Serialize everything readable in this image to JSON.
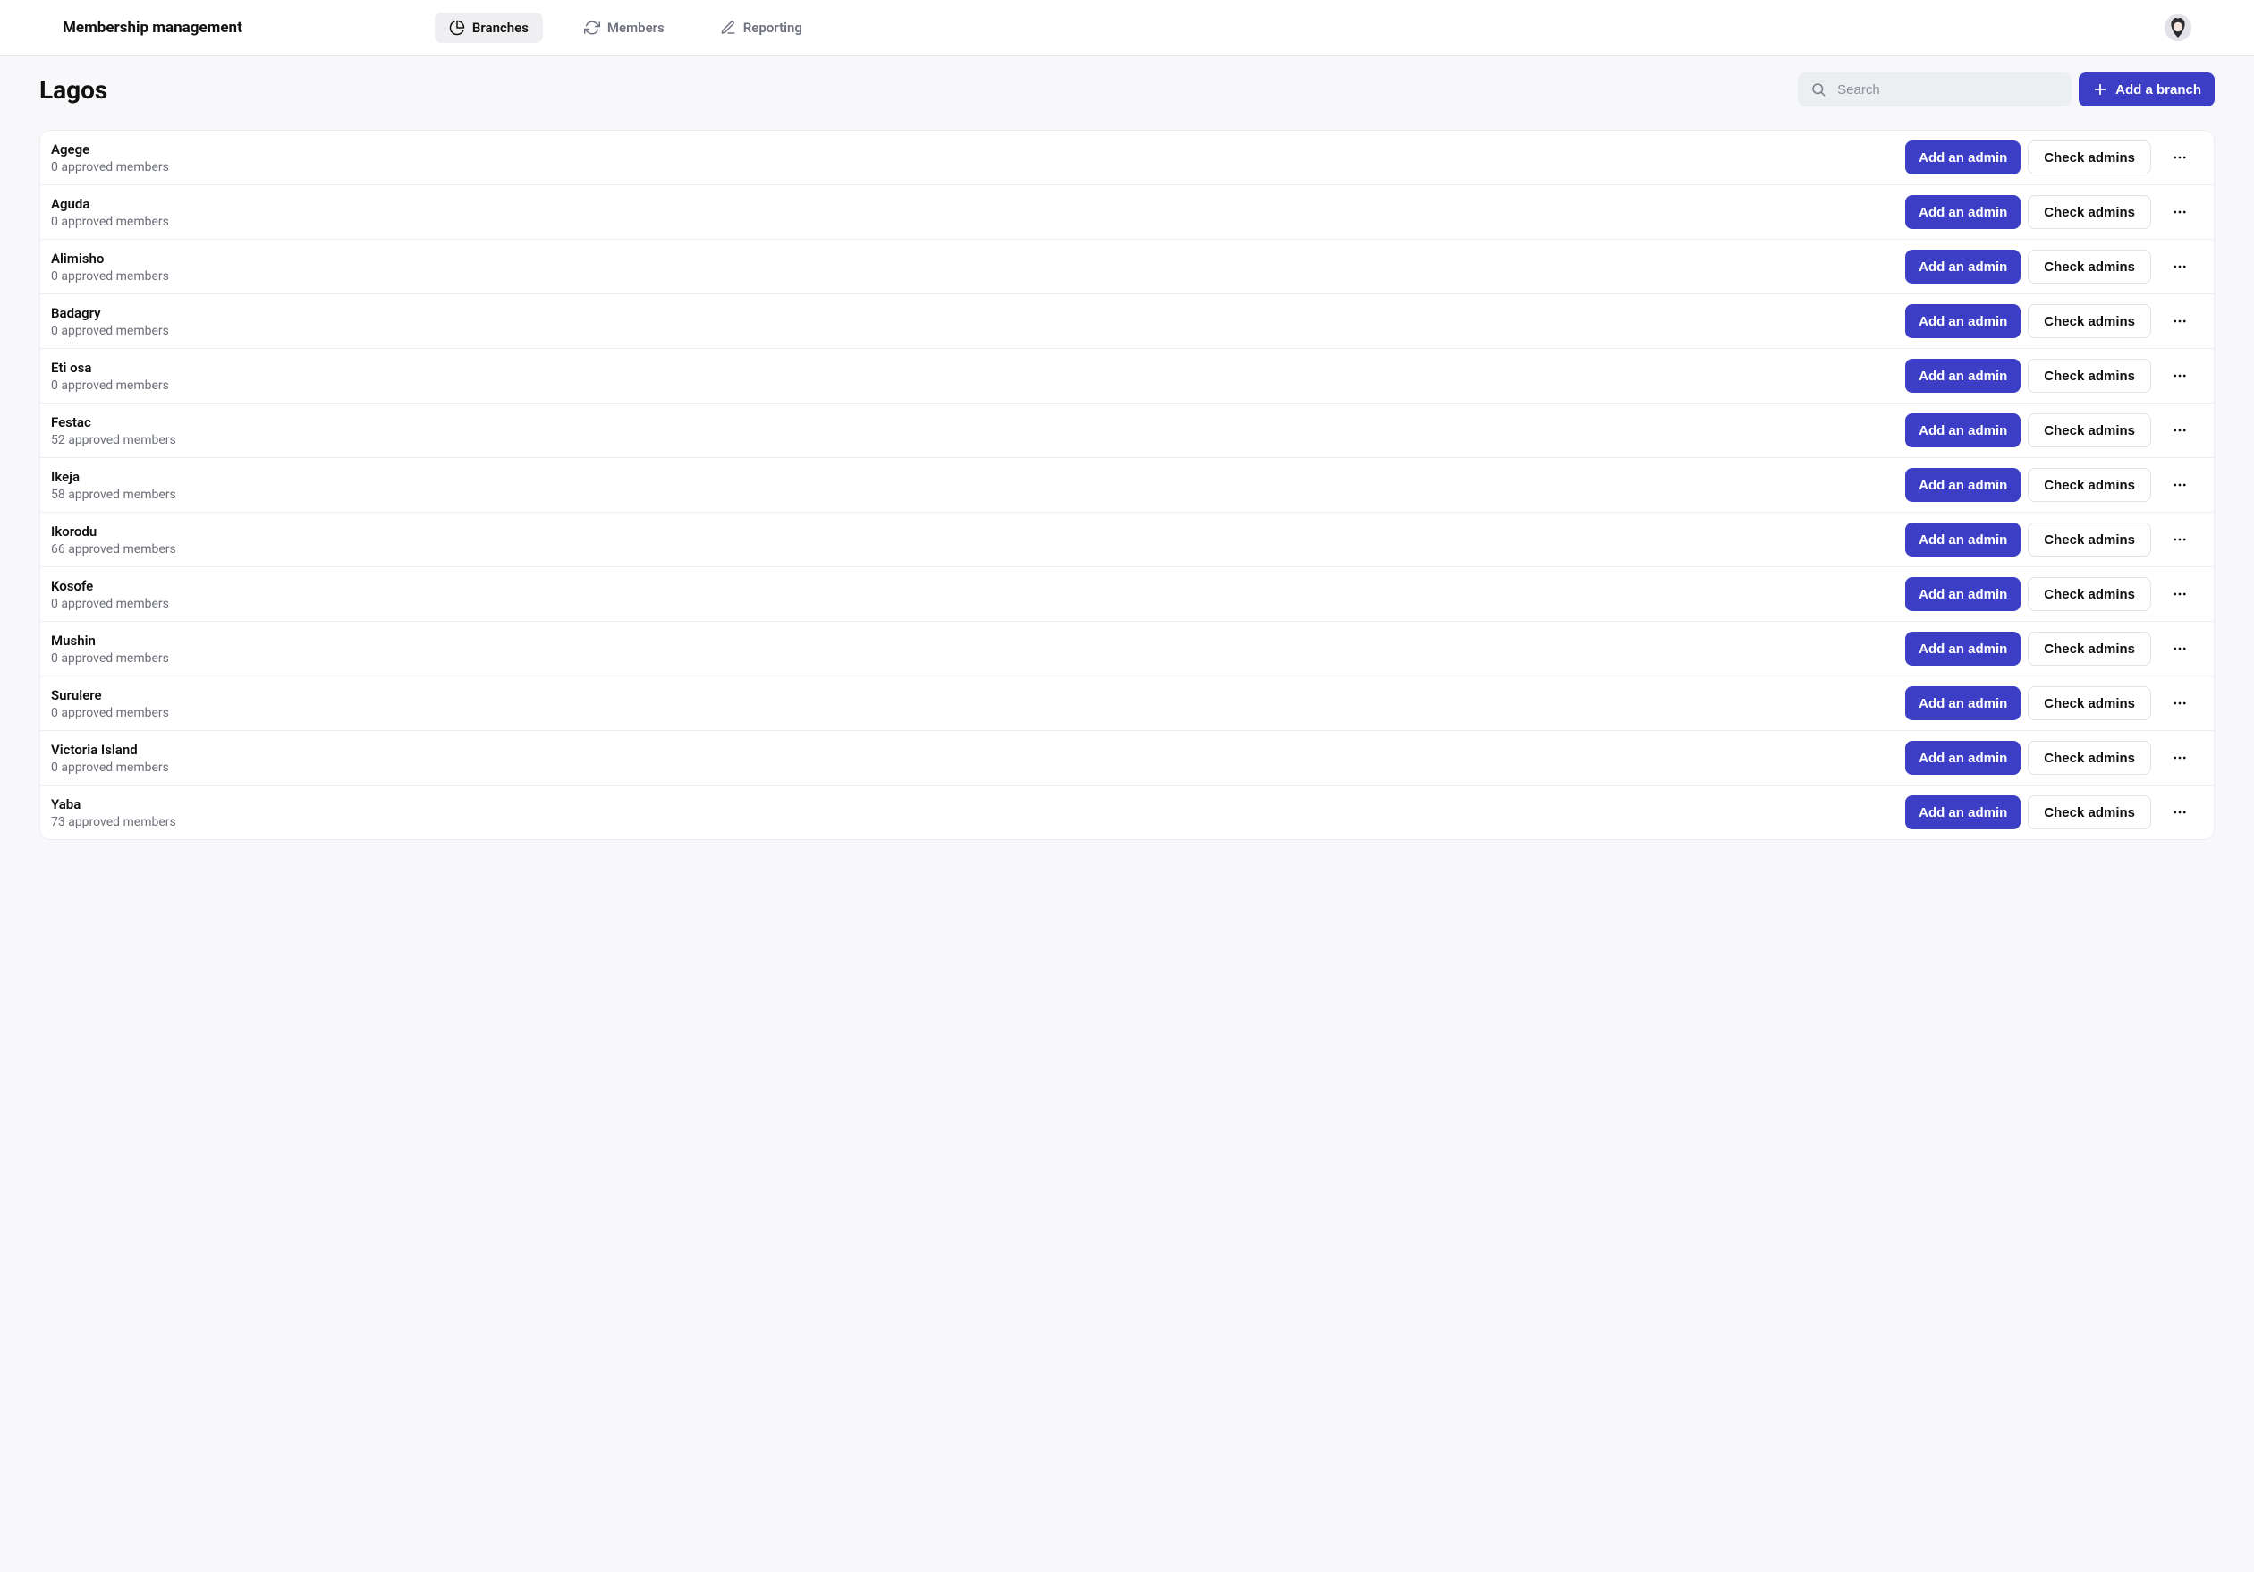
{
  "app_title": "Membership management",
  "nav": {
    "branches": "Branches",
    "members": "Members",
    "reporting": "Reporting"
  },
  "page": {
    "title": "Lagos",
    "search_placeholder": "Search",
    "add_branch_label": "Add a branch"
  },
  "row_labels": {
    "add_admin": "Add an admin",
    "check_admins": "Check admins",
    "members_suffix": " approved members"
  },
  "branches": [
    {
      "name": "Agege",
      "approved_members": 0
    },
    {
      "name": "Aguda",
      "approved_members": 0
    },
    {
      "name": "Alimisho",
      "approved_members": 0
    },
    {
      "name": "Badagry",
      "approved_members": 0
    },
    {
      "name": "Eti osa",
      "approved_members": 0
    },
    {
      "name": "Festac",
      "approved_members": 52
    },
    {
      "name": "Ikeja",
      "approved_members": 58
    },
    {
      "name": "Ikorodu",
      "approved_members": 66
    },
    {
      "name": "Kosofe",
      "approved_members": 0
    },
    {
      "name": "Mushin",
      "approved_members": 0
    },
    {
      "name": "Surulere",
      "approved_members": 0
    },
    {
      "name": "Victoria Island",
      "approved_members": 0
    },
    {
      "name": "Yaba",
      "approved_members": 73
    }
  ]
}
